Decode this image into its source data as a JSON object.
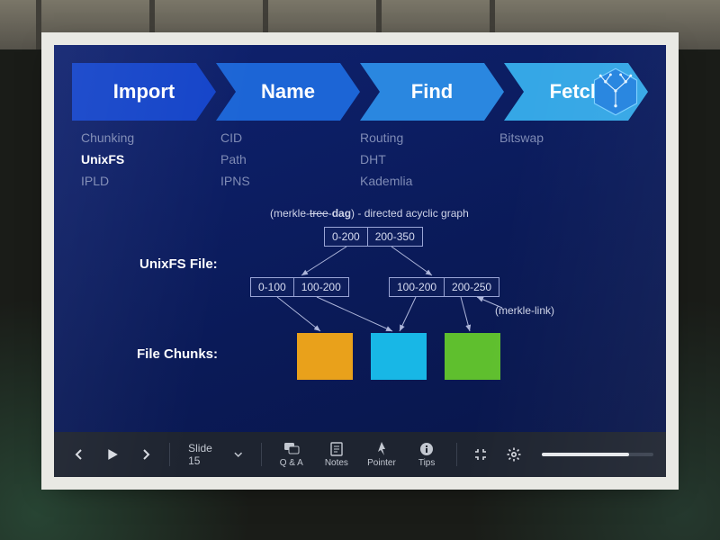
{
  "chevrons": [
    {
      "label": "Import",
      "color": "#1444c9"
    },
    {
      "label": "Name",
      "color": "#1c65d6"
    },
    {
      "label": "Find",
      "color": "#2a87e0"
    },
    {
      "label": "Fetch",
      "color": "#35a7e6"
    }
  ],
  "columns": {
    "import": [
      "Chunking",
      "UnixFS",
      "IPLD"
    ],
    "import_highlight_index": 1,
    "name": [
      "CID",
      "Path",
      "IPNS"
    ],
    "find": [
      "Routing",
      "DHT",
      "Kademlia"
    ],
    "fetch": [
      "Bitswap"
    ]
  },
  "diagram": {
    "label_unixfs": "UnixFS File:",
    "label_chunks": "File Chunks:",
    "caption_prefix": "(merkle-",
    "caption_strike": "tree",
    "caption_mid": "-",
    "caption_bold": "dag",
    "caption_suffix": ") - directed acyclic graph",
    "merkle_link": "(merkle-link)",
    "root": [
      "0-200",
      "200-350"
    ],
    "left": [
      "0-100",
      "100-200"
    ],
    "right": [
      "100-200",
      "200-250"
    ],
    "chunk_colors": [
      "#e9a11b",
      "#18b7e6",
      "#5fbf2e"
    ]
  },
  "toolbar": {
    "slide_label": "Slide 15",
    "qa": "Q & A",
    "notes": "Notes",
    "pointer": "Pointer",
    "tips": "Tips"
  }
}
